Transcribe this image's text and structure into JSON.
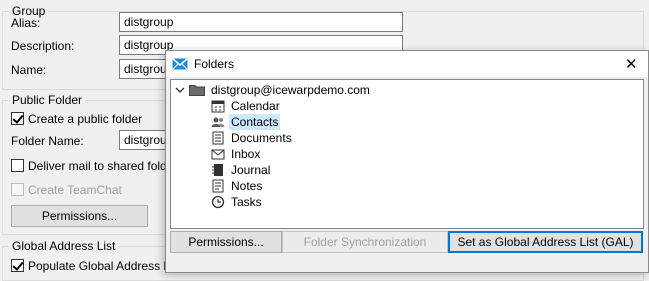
{
  "group_section": {
    "legend": "Group",
    "alias_label": "Alias:",
    "alias_value": "distgroup",
    "description_label": "Description:",
    "description_value": "distgroup",
    "name_label": "Name:",
    "name_value": "distgroup"
  },
  "public_folder": {
    "legend": "Public Folder",
    "create_label": "Create a public folder",
    "folder_name_label": "Folder Name:",
    "folder_name_value": "distgroup",
    "deliver_label": "Deliver mail to shared folder (",
    "teamchat_label": "Create TeamChat",
    "permissions_button": "Permissions..."
  },
  "gal_section": {
    "legend": "Global Address List",
    "populate_label": "Populate Global Address List (GAL) with all members"
  },
  "dialog": {
    "title": "Folders",
    "close_glyph": "✕",
    "accent_color": "#1e88e5",
    "root_account": "distgroup@icewarpdemo.com",
    "folders": [
      {
        "label": "Calendar",
        "icon": "calendar-icon"
      },
      {
        "label": "Contacts",
        "icon": "contacts-icon",
        "selected": true
      },
      {
        "label": "Documents",
        "icon": "documents-icon"
      },
      {
        "label": "Inbox",
        "icon": "inbox-icon"
      },
      {
        "label": "Journal",
        "icon": "journal-icon"
      },
      {
        "label": "Notes",
        "icon": "notes-icon"
      },
      {
        "label": "Tasks",
        "icon": "tasks-icon"
      }
    ],
    "permissions_button": "Permissions...",
    "sync_button": "Folder Synchronization",
    "gal_button": "Set as Global Address List (GAL)"
  }
}
